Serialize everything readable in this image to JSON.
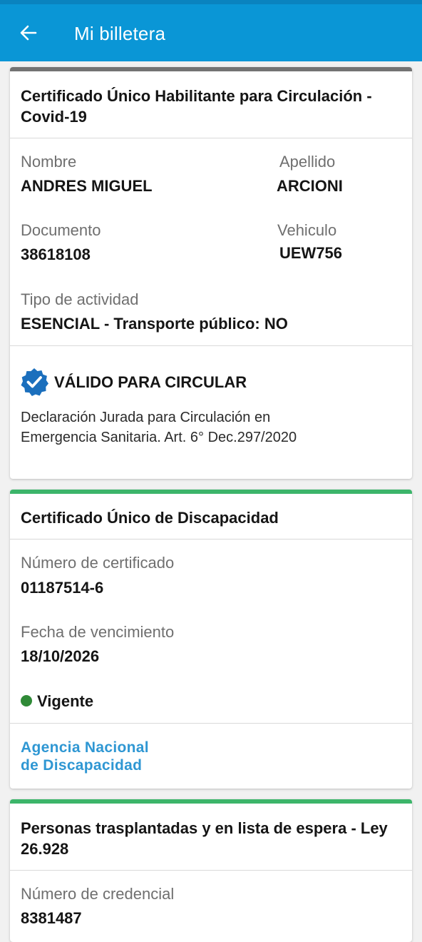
{
  "header": {
    "title": "Mi billetera"
  },
  "colors": {
    "accent": "#0a96d6",
    "card1_bar": "#737373",
    "card_bar_green": "#3cb56a",
    "status_green": "#2f8a37",
    "link": "#2f97d3"
  },
  "card1": {
    "title": "Certificado Único Habilitante para Circulación - Covid-19",
    "nombre_label": "Nombre",
    "nombre_value": "ANDRES MIGUEL",
    "apellido_label": "Apellido",
    "apellido_value": "ARCIONI",
    "documento_label": "Documento",
    "documento_value": "38618108",
    "vehiculo_label": "Vehiculo",
    "vehiculo_value": "UEW756",
    "actividad_label": "Tipo de actividad",
    "actividad_value": "ESENCIAL - Transporte público: NO",
    "valid_label": "VÁLIDO PARA CIRCULAR",
    "valid_icon": "verified-badge-icon",
    "note_line1": "Declaración Jurada para Circulación en",
    "note_line2": "Emergencia Sanitaria. Art. 6° Dec.297/2020"
  },
  "card2": {
    "title": "Certificado Único de Discapacidad",
    "numero_label": "Número de certificado",
    "numero_value": "01187514-6",
    "fecha_label": "Fecha de vencimiento",
    "fecha_value": "18/10/2026",
    "status": "Vigente",
    "link_line1": "Agencia Nacional",
    "link_line2": "de Discapacidad"
  },
  "card3": {
    "title": "Personas trasplantadas y en lista de espera - Ley 26.928",
    "credencial_label": "Número de credencial",
    "credencial_value": "8381487"
  }
}
